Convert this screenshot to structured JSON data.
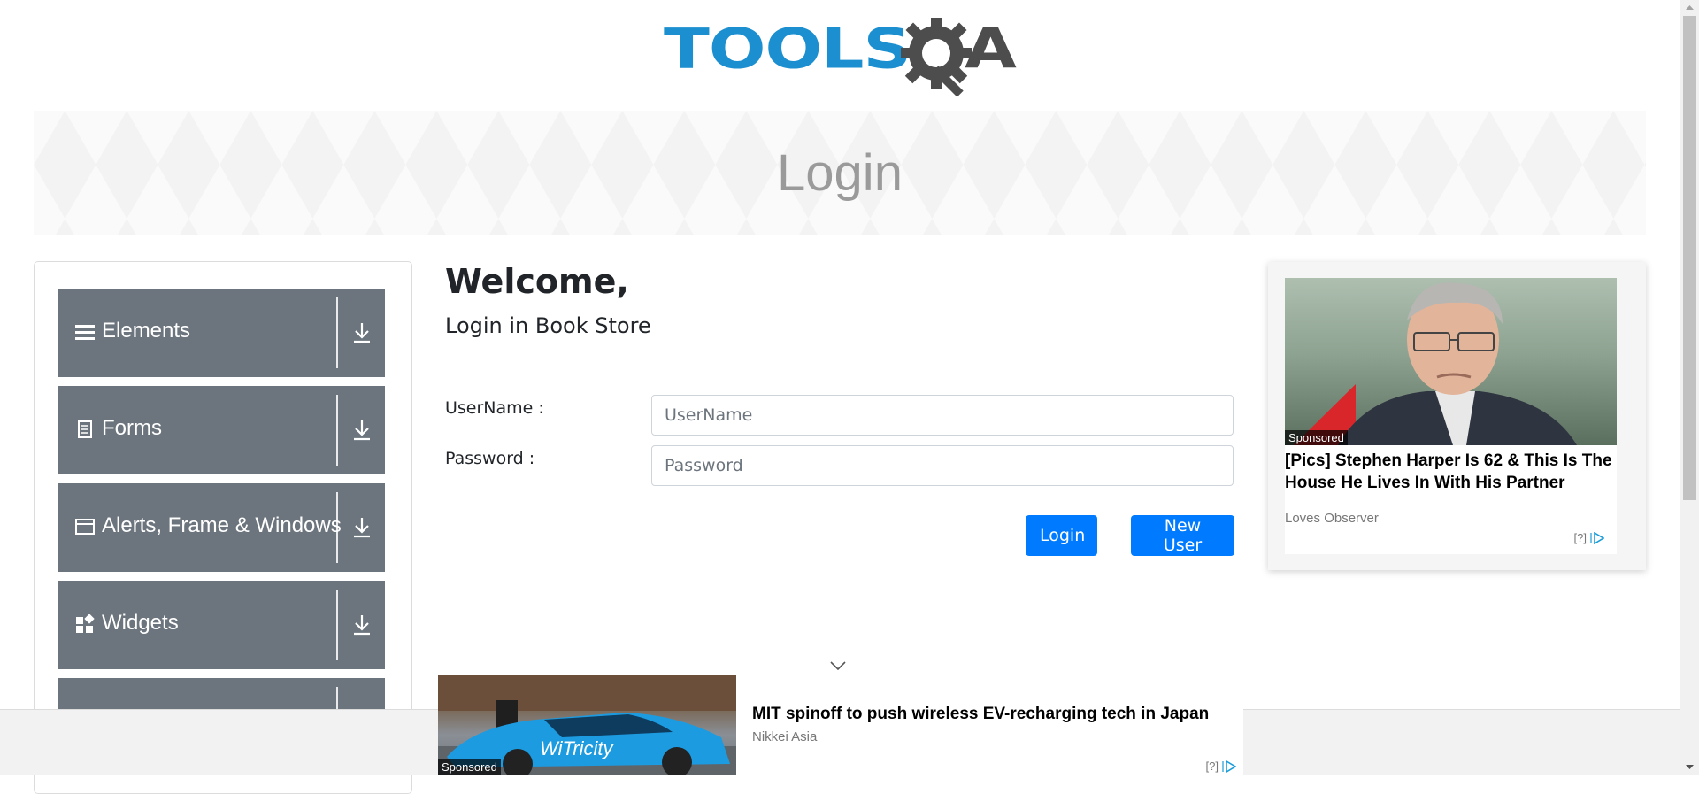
{
  "brand": {
    "logo_text": "TOOLS",
    "logo_suffix": "A",
    "logo_colors": {
      "primary": "#1b8fcf",
      "secondary": "#4d4d4d"
    }
  },
  "banner": {
    "title": "Login"
  },
  "menu": {
    "groups": [
      {
        "label": "Elements",
        "icon": "hamburger-icon"
      },
      {
        "label": "Forms",
        "icon": "document-icon"
      },
      {
        "label": "Alerts, Frame & Windows",
        "icon": "window-icon"
      },
      {
        "label": "Widgets",
        "icon": "widgets-icon"
      },
      {
        "label": "",
        "icon": ""
      }
    ]
  },
  "login": {
    "heading": "Welcome,",
    "subheading": "Login in Book Store",
    "username_label": "UserName :",
    "username_placeholder": "UserName",
    "password_label": "Password :",
    "password_placeholder": "Password",
    "login_button": "Login",
    "new_user_button": "New User"
  },
  "ad_right": {
    "sponsored": "Sponsored",
    "title": "[Pics] Stephen Harper Is 62 & This Is The House He Lives In With His Partner",
    "source": "Loves Observer",
    "info": "[?]"
  },
  "ad_bottom": {
    "sponsored": "Sponsored",
    "title": "MIT spinoff to push wireless EV-recharging tech in Japan",
    "source": "Nikkei Asia",
    "info": "[?]",
    "car_text": "WiTricity"
  },
  "colors": {
    "primary": "#007bff",
    "menu": "#6c757d"
  }
}
